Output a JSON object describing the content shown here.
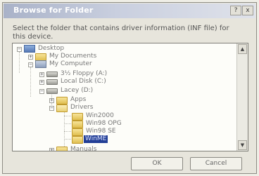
{
  "window": {
    "title": "Browse for Folder"
  },
  "instruction": "Select the folder that contains driver information (INF file) for\nthis device.",
  "tree": [
    {
      "label": "Desktop",
      "icon": "desktop-icon",
      "expander": "−"
    },
    {
      "label": "My Documents",
      "icon": "folder-icon",
      "expander": "+"
    },
    {
      "label": "My Computer",
      "icon": "computer-icon",
      "expander": "−"
    },
    {
      "label": "3½ Floppy (A:)",
      "icon": "floppy-drive-icon",
      "expander": "+"
    },
    {
      "label": "Local Disk (C:)",
      "icon": "hard-drive-icon",
      "expander": "+"
    },
    {
      "label": "Lacey (D:)",
      "icon": "hard-drive-icon",
      "expander": "−"
    },
    {
      "label": "Apps",
      "icon": "folder-icon",
      "expander": "+"
    },
    {
      "label": "Drivers",
      "icon": "folder-open-icon",
      "expander": "−"
    },
    {
      "label": "Win2000",
      "icon": "folder-icon",
      "expander": ""
    },
    {
      "label": "Win98 OPG",
      "icon": "folder-icon",
      "expander": ""
    },
    {
      "label": "Win98 SE",
      "icon": "folder-icon",
      "expander": ""
    },
    {
      "label": "WinME",
      "icon": "folder-icon",
      "expander": "",
      "selected": true
    },
    {
      "label": "Manuals",
      "icon": "folder-icon",
      "expander": "+"
    }
  ],
  "buttons": {
    "ok": "OK",
    "cancel": "Cancel"
  },
  "titlebar": {
    "help_glyph": "?",
    "close_glyph": "x"
  }
}
